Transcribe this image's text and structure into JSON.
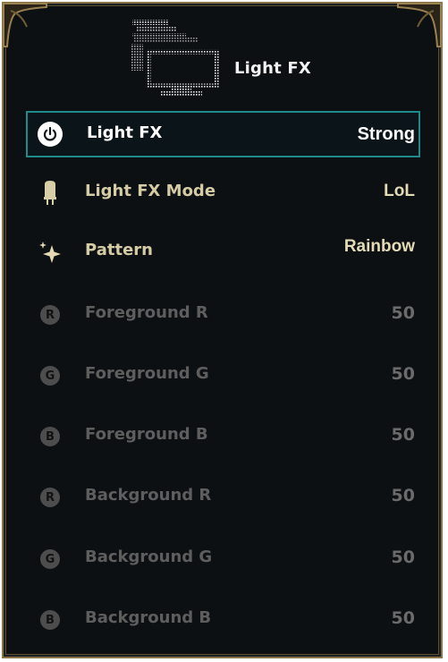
{
  "header": {
    "title": "Light FX",
    "icon": "monitor-icon"
  },
  "rows": [
    {
      "label": "Light FX",
      "value": "Strong",
      "icon": "power-icon"
    },
    {
      "label": "Light FX Mode",
      "value": "LoL",
      "icon": "candle-icon"
    },
    {
      "label": "Pattern",
      "value": "Rainbow",
      "icon": "sparkle-icon"
    },
    {
      "label": "Foreground R",
      "value": "50",
      "icon": "r-badge-icon",
      "badge": "R"
    },
    {
      "label": "Foreground G",
      "value": "50",
      "icon": "g-badge-icon",
      "badge": "G"
    },
    {
      "label": "Foreground B",
      "value": "50",
      "icon": "b-badge-icon",
      "badge": "B"
    },
    {
      "label": "Background R",
      "value": "50",
      "icon": "r-badge-icon",
      "badge": "R"
    },
    {
      "label": "Background G",
      "value": "50",
      "icon": "g-badge-icon",
      "badge": "G"
    },
    {
      "label": "Background B",
      "value": "50",
      "icon": "b-badge-icon",
      "badge": "B"
    }
  ],
  "colors": {
    "frame": "#8a7345",
    "selection": "#1e8a8a",
    "active_text": "#d5cba4",
    "disabled_text": "#5e5e5e",
    "background": "#0d1013"
  }
}
